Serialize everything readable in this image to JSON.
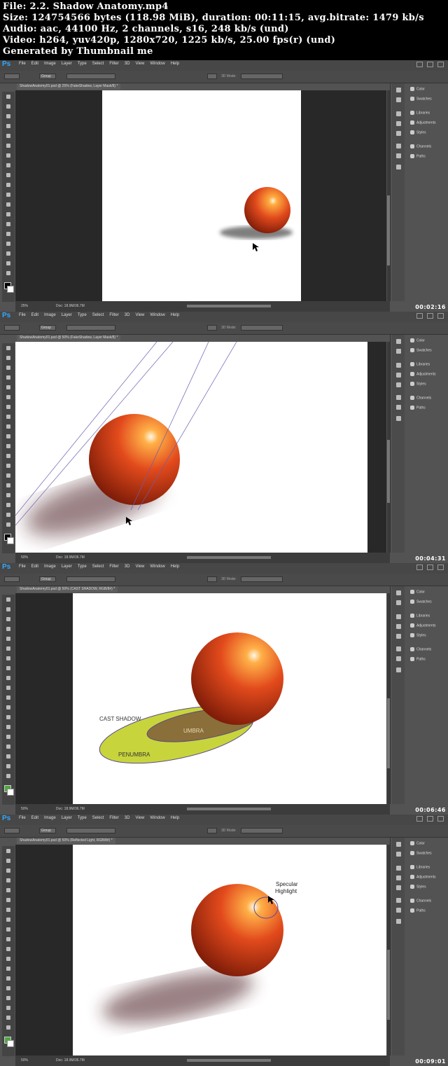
{
  "header": {
    "line1": "File: 2.2. Shadow Anatomy.mp4",
    "line2": "Size: 124754566 bytes (118.98 MiB), duration: 00:11:15, avg.bitrate: 1479 kb/s",
    "line3": "Audio: aac, 44100 Hz, 2 channels, s16, 248 kb/s (und)",
    "line4": "Video: h264, yuv420p, 1280x720, 1225 kb/s, 25.00 fps(r) (und)",
    "line5": "Generated by Thumbnail me"
  },
  "app": {
    "logo": "Ps",
    "menus": [
      "File",
      "Edit",
      "Image",
      "Layer",
      "Type",
      "Select",
      "Filter",
      "3D",
      "View",
      "Window",
      "Help"
    ],
    "mode_label": "3D Mode:",
    "group_label": "Group",
    "panels": [
      "Color",
      "Swatches",
      "Libraries",
      "Adjustments",
      "Styles",
      "Channels",
      "Paths"
    ]
  },
  "frames": [
    {
      "doc_tab": "ShadowAnatomy01.psd @ 25% (FakeShadow, Layer Mask/8) *",
      "zoom": "25%",
      "doc_size": "Doc: 18.9M/36.7M",
      "timestamp": "00:02:16",
      "primary_color": "#000000",
      "labels": []
    },
    {
      "doc_tab": "ShadowAnatomy01.psd @ 50% (FakeShadow, Layer Mask/8) *",
      "zoom": "50%",
      "doc_size": "Doc: 18.9M/36.7M",
      "timestamp": "00:04:31",
      "primary_color": "#000000",
      "labels": []
    },
    {
      "doc_tab": "ShadowAnatomy01.psd @ 50% (CAST SHADOW, RGB/8#) *",
      "zoom": "50%",
      "doc_size": "Doc: 18.9M/36.7M",
      "timestamp": "00:06:46",
      "primary_color": "#4fa83c",
      "labels": [
        "CAST SHADOW",
        "UMBRA",
        "PENUMBRA"
      ]
    },
    {
      "doc_tab": "ShadowAnatomy01.psd @ 50% (Reflected Light, RGB/8#) *",
      "zoom": "50%",
      "doc_size": "Doc: 18.9M/36.7M",
      "timestamp": "00:09:01",
      "primary_color": "#4fa83c",
      "labels": [
        "Specular",
        "Highlight"
      ]
    }
  ],
  "colors": {
    "ui_bg": "#535353",
    "menubar": "#474747",
    "workspace": "#282828",
    "ps_blue": "#31a8ff",
    "sphere": "#e0491c",
    "penumbra": "#c8d43c",
    "umbra": "#8a6f3a"
  }
}
